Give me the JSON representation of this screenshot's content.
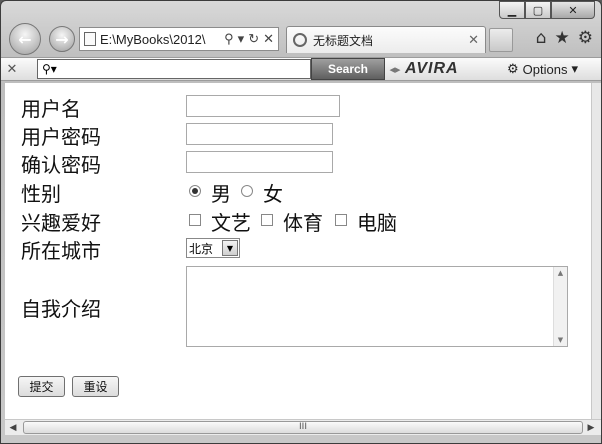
{
  "browser": {
    "address_url": "E:\\MyBooks\\2012\\",
    "tab_title": "无标题文档",
    "search_button_label": "Search",
    "brand_label": "AVIRA",
    "options_label": "Options",
    "hscroll_grip": "III"
  },
  "form": {
    "username_label": "用户名",
    "password_label": "用户密码",
    "confirm_label": "确认密码",
    "gender_label": "性别",
    "gender_options": [
      "男",
      "女"
    ],
    "gender_selected": "男",
    "hobby_label": "兴趣爱好",
    "hobby_options": [
      "文艺",
      "体育",
      "电脑"
    ],
    "city_label": "所在城市",
    "city_selected": "北京",
    "intro_label": "自我介绍",
    "submit_label": "提交",
    "reset_label": "重设"
  }
}
